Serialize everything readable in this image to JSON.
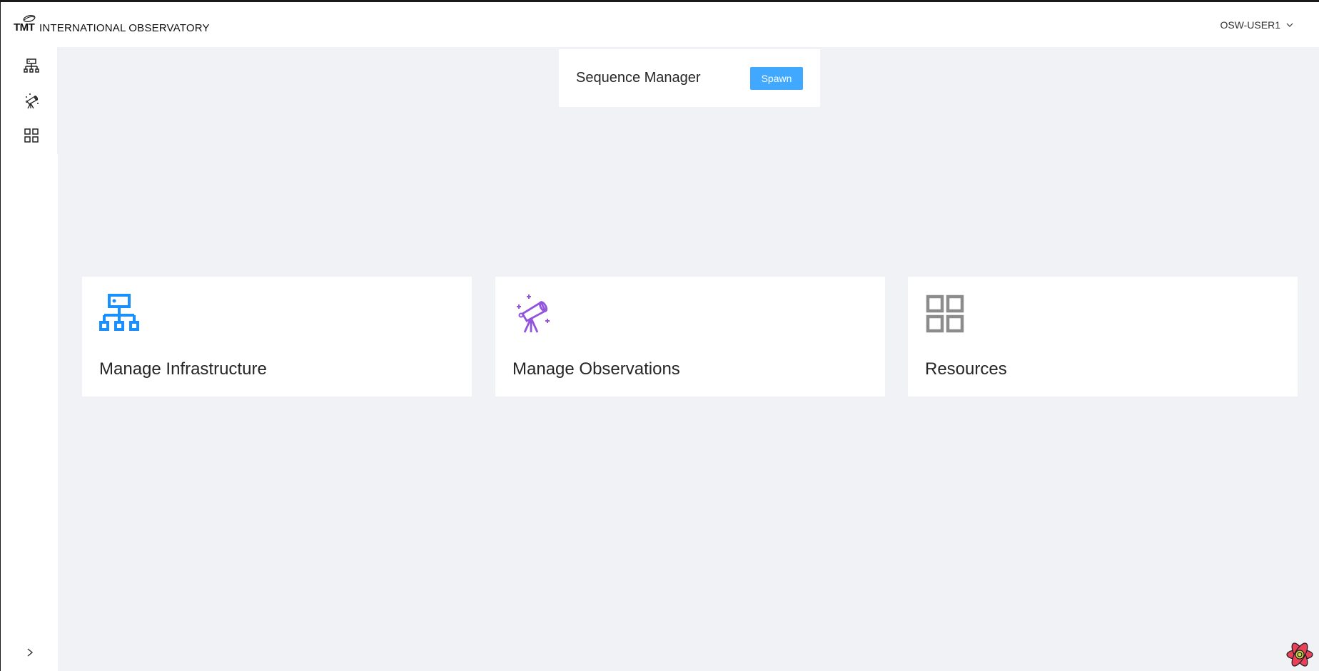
{
  "header": {
    "logo_text": "TMT",
    "brand_name": "INTERNATIONAL OBSERVATORY",
    "user": "OSW-USER1"
  },
  "sidebar": {
    "items": [
      {
        "icon": "network-icon"
      },
      {
        "icon": "telescope-icon"
      },
      {
        "icon": "grid-icon"
      }
    ],
    "collapse_icon": "chevron-right-icon"
  },
  "sequence_manager": {
    "title": "Sequence Manager",
    "button_label": "Spawn"
  },
  "cards": [
    {
      "title": "Manage Infrastructure",
      "icon": "network-icon",
      "color": "#1890ff"
    },
    {
      "title": "Manage Observations",
      "icon": "telescope-icon",
      "color": "#9254de"
    },
    {
      "title": "Resources",
      "icon": "grid-icon",
      "color": "#8c8c8c"
    }
  ],
  "colors": {
    "primary": "#40a9ff",
    "background": "#f0f2f5",
    "surface": "#ffffff"
  }
}
